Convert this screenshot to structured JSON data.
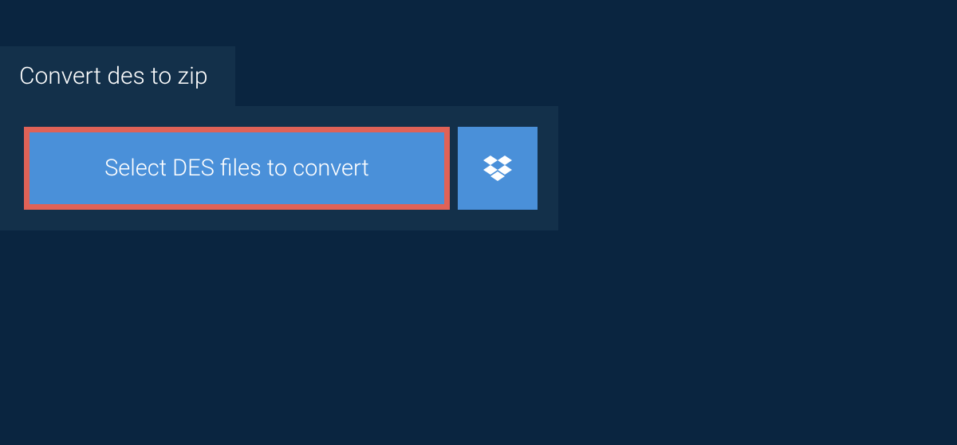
{
  "tab": {
    "label": "Convert des to zip"
  },
  "buttons": {
    "select_label": "Select DES files to convert"
  },
  "colors": {
    "background": "#0a2540",
    "panel": "#13304a",
    "button": "#4a90d9",
    "border": "#e06257"
  }
}
